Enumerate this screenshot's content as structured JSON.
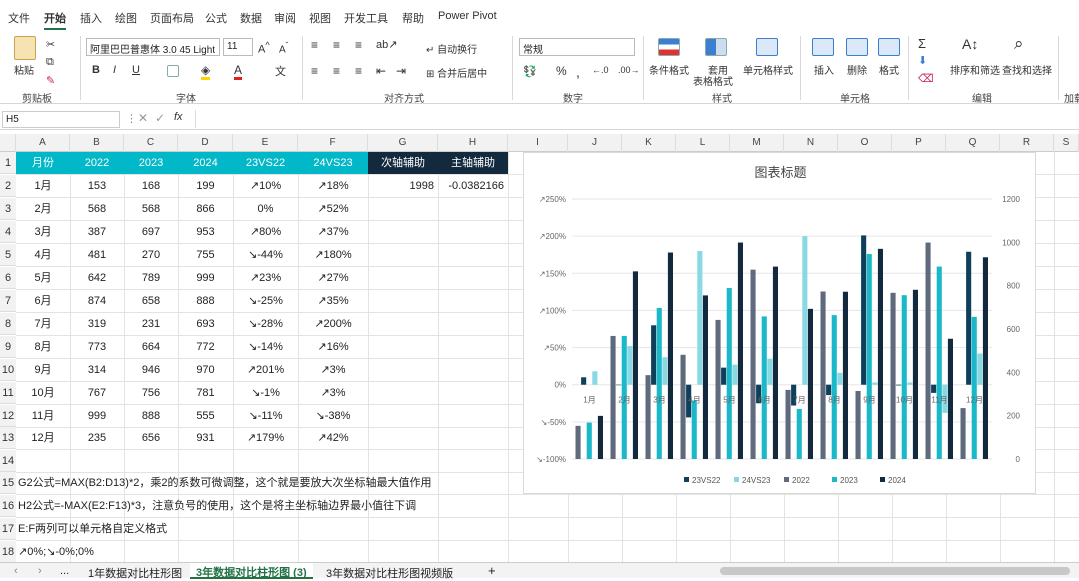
{
  "menu": [
    "文件",
    "开始",
    "插入",
    "绘图",
    "页面布局",
    "公式",
    "数据",
    "审阅",
    "视图",
    "开发工具",
    "帮助",
    "Power Pivot"
  ],
  "ribbon": {
    "paste": "粘贴",
    "clipboard": "剪贴板",
    "font_name": "阿里巴巴普惠体 3.0 45 Light",
    "font_size": "11",
    "font_group": "字体",
    "wrap_text": "自动换行",
    "merge_center": "合并后居中",
    "align_group": "对齐方式",
    "number_format": "常规",
    "number_group": "数字",
    "cond_format": "条件格式",
    "table_format_1": "套用",
    "table_format_2": "表格格式",
    "cell_style": "单元格样式",
    "styles_group": "样式",
    "insert": "插入",
    "delete": "删除",
    "format": "格式",
    "cells_group": "单元格",
    "sort_filter": "排序和筛选",
    "find_select": "查找和选择",
    "edit_group": "编辑",
    "addin_group": "加载"
  },
  "formula_bar": {
    "name_box": "H5",
    "fx": "fx",
    "formula": ""
  },
  "columns": [
    "A",
    "B",
    "C",
    "D",
    "E",
    "F",
    "G",
    "H",
    "I",
    "J",
    "K",
    "L",
    "M",
    "N",
    "O",
    "P",
    "Q",
    "R",
    "S"
  ],
  "table": {
    "headers": [
      "月份",
      "2022",
      "2023",
      "2024",
      "23VS22",
      "24VS23"
    ],
    "rows": [
      [
        "1月",
        "153",
        "168",
        "199",
        "↗10%",
        "↗18%"
      ],
      [
        "2月",
        "568",
        "568",
        "866",
        "0%",
        "↗52%"
      ],
      [
        "3月",
        "387",
        "697",
        "953",
        "↗80%",
        "↗37%"
      ],
      [
        "4月",
        "481",
        "270",
        "755",
        "↘-44%",
        "↗180%"
      ],
      [
        "5月",
        "642",
        "789",
        "999",
        "↗23%",
        "↗27%"
      ],
      [
        "6月",
        "874",
        "658",
        "888",
        "↘-25%",
        "↗35%"
      ],
      [
        "7月",
        "319",
        "231",
        "693",
        "↘-28%",
        "↗200%"
      ],
      [
        "8月",
        "773",
        "664",
        "772",
        "↘-14%",
        "↗16%"
      ],
      [
        "9月",
        "314",
        "946",
        "970",
        "↗201%",
        "↗3%"
      ],
      [
        "10月",
        "767",
        "756",
        "781",
        "↘-1%",
        "↗3%"
      ],
      [
        "11月",
        "999",
        "888",
        "555",
        "↘-11%",
        "↘-38%"
      ],
      [
        "12月",
        "235",
        "656",
        "931",
        "↗179%",
        "↗42%"
      ]
    ],
    "aux_headers": [
      "次轴辅助",
      "主轴辅助"
    ],
    "aux_values": [
      "1998",
      "-0.0382166"
    ]
  },
  "row_numbers": [
    "1",
    "2",
    "3",
    "4",
    "5",
    "6",
    "7",
    "8",
    "9",
    "10",
    "11",
    "12",
    "13",
    "14",
    "15",
    "16",
    "17",
    "18"
  ],
  "notes": {
    "r15": "G2公式=MAX(B2:D13)*2，乘2的系数可微调整，这个就是要放大次坐标轴最大值作用",
    "r16": "H2公式=-MAX(E2:F13)*3，注意负号的使用，这个是将主坐标轴边界最小值往下调",
    "r17": "E:F两列可以单元格自定义格式",
    "r18": "↗0%;↘-0%;0%"
  },
  "chart_data": {
    "type": "bar",
    "title": "图表标题",
    "categories": [
      "1月",
      "2月",
      "3月",
      "4月",
      "5月",
      "6月",
      "7月",
      "8月",
      "9月",
      "10月",
      "11月",
      "12月"
    ],
    "series": [
      {
        "name": "23VS22",
        "axis": "primary",
        "color": "#0e3f5b",
        "values": [
          0.1,
          0.0,
          0.8,
          -0.44,
          0.23,
          -0.25,
          -0.28,
          -0.14,
          2.01,
          -0.01,
          -0.11,
          1.79
        ]
      },
      {
        "name": "24VS23",
        "axis": "primary",
        "color": "#88d9e3",
        "values": [
          0.18,
          0.52,
          0.37,
          1.8,
          0.27,
          0.35,
          2.0,
          0.16,
          0.03,
          0.03,
          -0.38,
          0.42
        ]
      },
      {
        "name": "2022",
        "axis": "secondary",
        "color": "#5f6b7d",
        "values": [
          153,
          568,
          387,
          481,
          642,
          874,
          319,
          773,
          314,
          767,
          999,
          235
        ]
      },
      {
        "name": "2023",
        "axis": "secondary",
        "color": "#1ab8c8",
        "values": [
          168,
          568,
          697,
          270,
          789,
          658,
          231,
          664,
          946,
          756,
          888,
          656
        ]
      },
      {
        "name": "2024",
        "axis": "secondary",
        "color": "#13293d",
        "values": [
          199,
          866,
          953,
          755,
          999,
          888,
          693,
          772,
          970,
          781,
          555,
          931
        ]
      }
    ],
    "primary_ticks": [
      "↗250%",
      "↗200%",
      "↗150%",
      "↗100%",
      "↗50%",
      "0%",
      "↘-50%",
      "↘-100%"
    ],
    "primary_range": [
      -1.0,
      2.5
    ],
    "secondary_ticks": [
      "1200",
      "1000",
      "800",
      "600",
      "400",
      "200",
      "0"
    ],
    "secondary_range": [
      0,
      1200
    ],
    "legend_position": "bottom"
  },
  "sheet_tabs": [
    "1年数据对比柱形图",
    "3年数据对比柱形图 (3)",
    "3年数据对比柱形图视频版"
  ],
  "sheet_more": "...",
  "add_sheet": "+"
}
